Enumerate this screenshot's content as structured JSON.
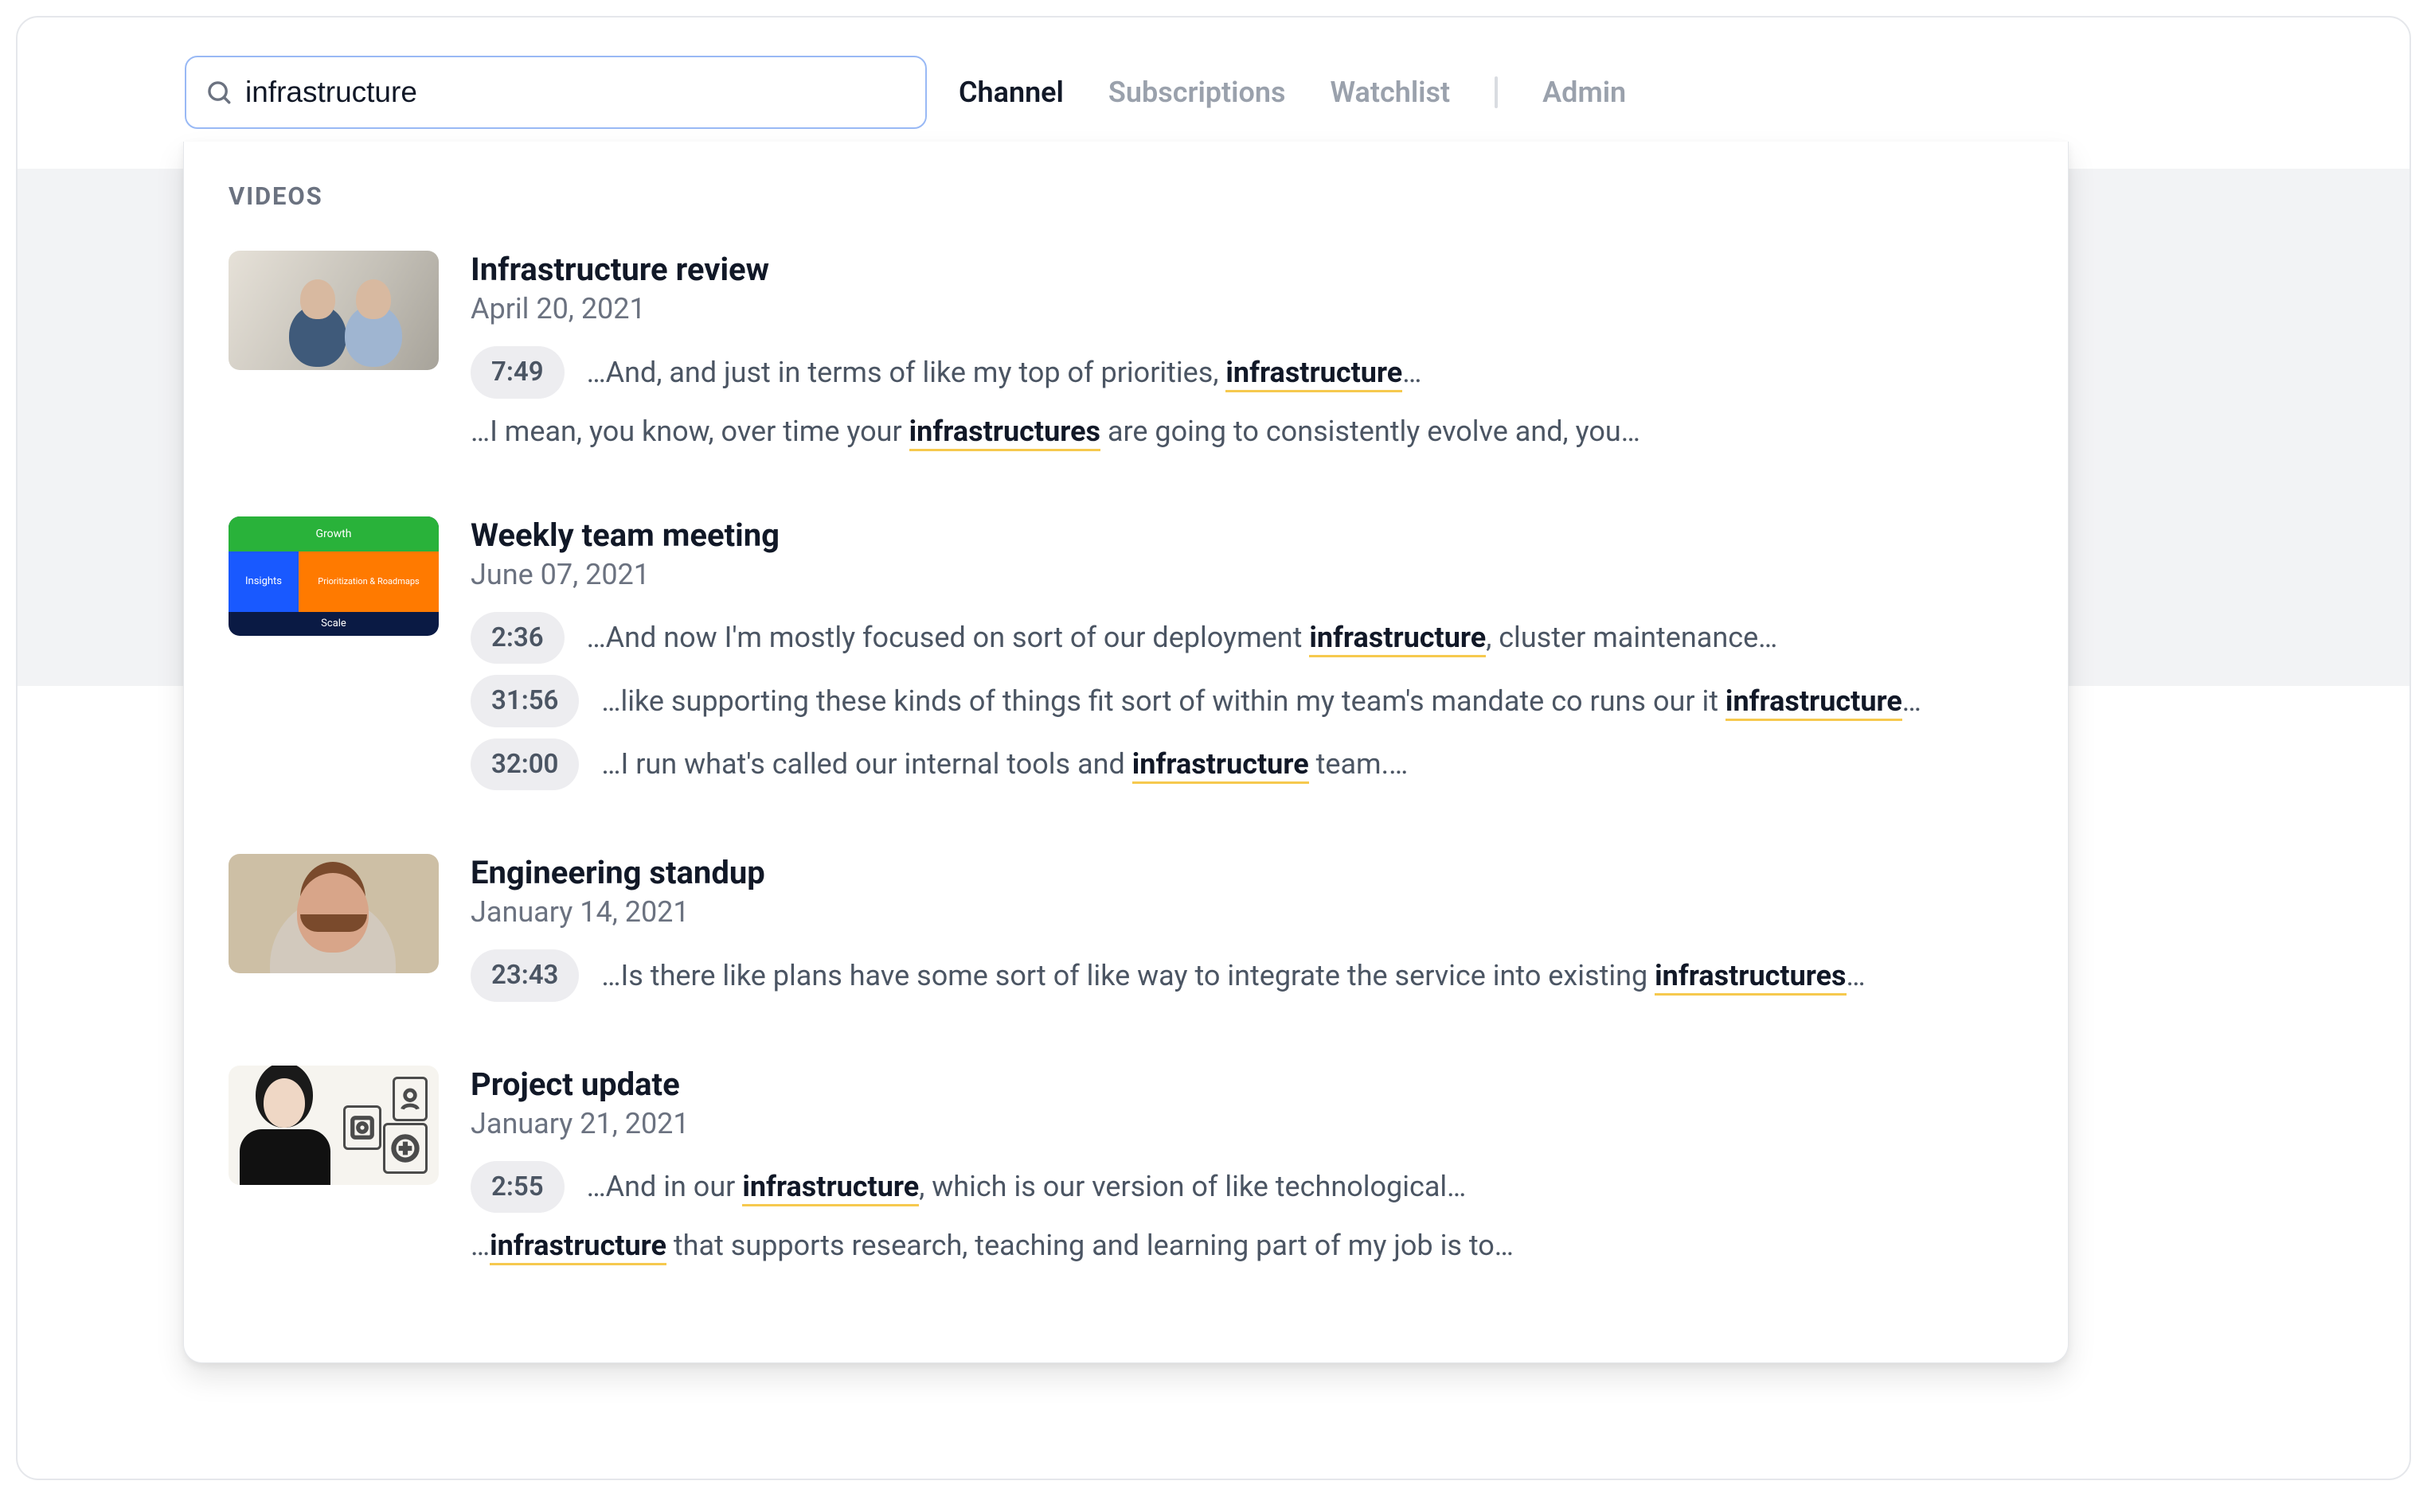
{
  "search": {
    "value": "infrastructure",
    "placeholder": "Search"
  },
  "nav": {
    "channel": "Channel",
    "subscriptions": "Subscriptions",
    "watchlist": "Watchlist",
    "admin": "Admin"
  },
  "section_label": "VIDEOS",
  "results": [
    {
      "title": "Infrastructure review",
      "date": "April 20, 2021",
      "snippets": [
        {
          "ts": "7:49",
          "pre": "…And, and just in terms of like my top of priorities, ",
          "hl": "infrastructure",
          "post": "…"
        },
        {
          "ts": "",
          "pre": "…I mean, you know, over time your ",
          "hl": "infrastructures",
          "post": " are going to consistently evolve and, you…"
        }
      ]
    },
    {
      "title": "Weekly team meeting",
      "date": "June 07, 2021",
      "snippets": [
        {
          "ts": "2:36",
          "pre": "…And now I'm mostly focused on sort of our deployment ",
          "hl": "infrastructure",
          "post": ", cluster maintenance…"
        },
        {
          "ts": "31:56",
          "pre": "…like supporting these kinds of things fit sort of within my team's mandate co runs our it ",
          "hl": "infrastructure",
          "post": "…"
        },
        {
          "ts": "32:00",
          "pre": "…I run what's called our internal tools and ",
          "hl": "infrastructure",
          "post": " team.…"
        }
      ]
    },
    {
      "title": "Engineering standup",
      "date": "January 14, 2021",
      "snippets": [
        {
          "ts": "23:43",
          "pre": "…Is there like plans have some sort of like way to integrate the service into existing ",
          "hl": "infrastructures",
          "post": "…"
        }
      ]
    },
    {
      "title": "Project update",
      "date": "January 21, 2021",
      "snippets": [
        {
          "ts": "2:55",
          "pre": "…And in our ",
          "hl": "infrastructure",
          "post": ", which is our version of like technological…"
        },
        {
          "ts": "",
          "pre": "…",
          "hl": "infrastructure",
          "post": " that supports research, teaching and learning part of my job is to…"
        }
      ]
    }
  ],
  "thumb2": {
    "r1": "Growth",
    "r2l": "Insights",
    "r2r": "Prioritization & Roadmaps",
    "r3": "Scale"
  }
}
